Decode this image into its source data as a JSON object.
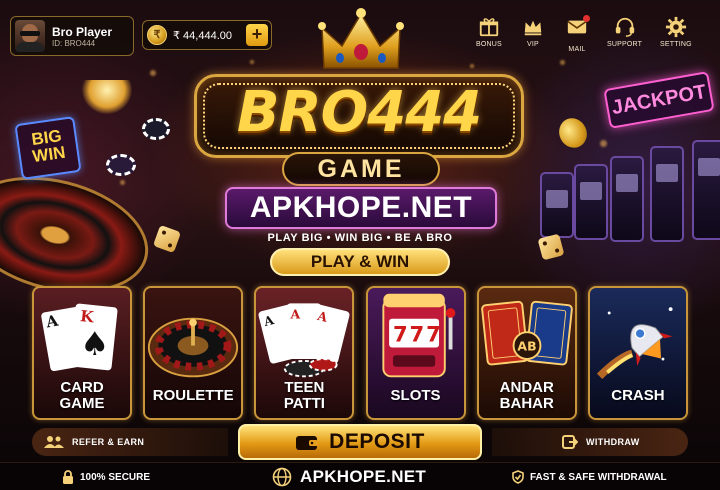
{
  "player": {
    "name": "Bro Player",
    "id": "ID: BRO444"
  },
  "wallet": {
    "currency_icon": "coin-icon",
    "coin_glyph": "₹",
    "balance": "₹ 44,444.00",
    "add_label": "+"
  },
  "nav": [
    {
      "label": "BONUS",
      "icon": "gift-icon"
    },
    {
      "label": "VIP",
      "icon": "crown-icon"
    },
    {
      "label": "MAIL",
      "icon": "mail-icon"
    },
    {
      "label": "SUPPORT",
      "icon": "headset-icon"
    },
    {
      "label": "SETTING",
      "icon": "gear-icon"
    }
  ],
  "logo": {
    "title": "BRO444",
    "subtitle": "GAME",
    "site": "APKHOPE.NET",
    "tagline": "PLAY BIG • WIN BIG • BE A BRO",
    "cta": "PLAY & WIN"
  },
  "scenery": {
    "big_win_line1": "BIG",
    "big_win_line2": "WIN",
    "jackpot": "JACKPOT"
  },
  "games": [
    {
      "line1": "CARD",
      "line2": "GAME"
    },
    {
      "line1": "ROULETTE",
      "line2": ""
    },
    {
      "line1": "TEEN",
      "line2": "PATTI"
    },
    {
      "line1": "SLOTS",
      "line2": ""
    },
    {
      "line1": "ANDAR",
      "line2": "BAHAR"
    },
    {
      "line1": "CRASH",
      "line2": ""
    }
  ],
  "card_art": {
    "c1": "A",
    "c2": "K",
    "suit": "♠",
    "ab_badge": "AB",
    "slot_digits": "777"
  },
  "actions": {
    "refer": "REFER & EARN",
    "deposit": "DEPOSIT",
    "withdraw": "WITHDRAW"
  },
  "footer": {
    "secure": "100% SECURE",
    "site": "APKHOPE.NET",
    "fast": "FAST & SAFE WITHDRAWAL"
  },
  "colors": {
    "gold": "#ffd54a",
    "neon_pink": "#e07ad8",
    "tile_border": "#c9953a"
  }
}
